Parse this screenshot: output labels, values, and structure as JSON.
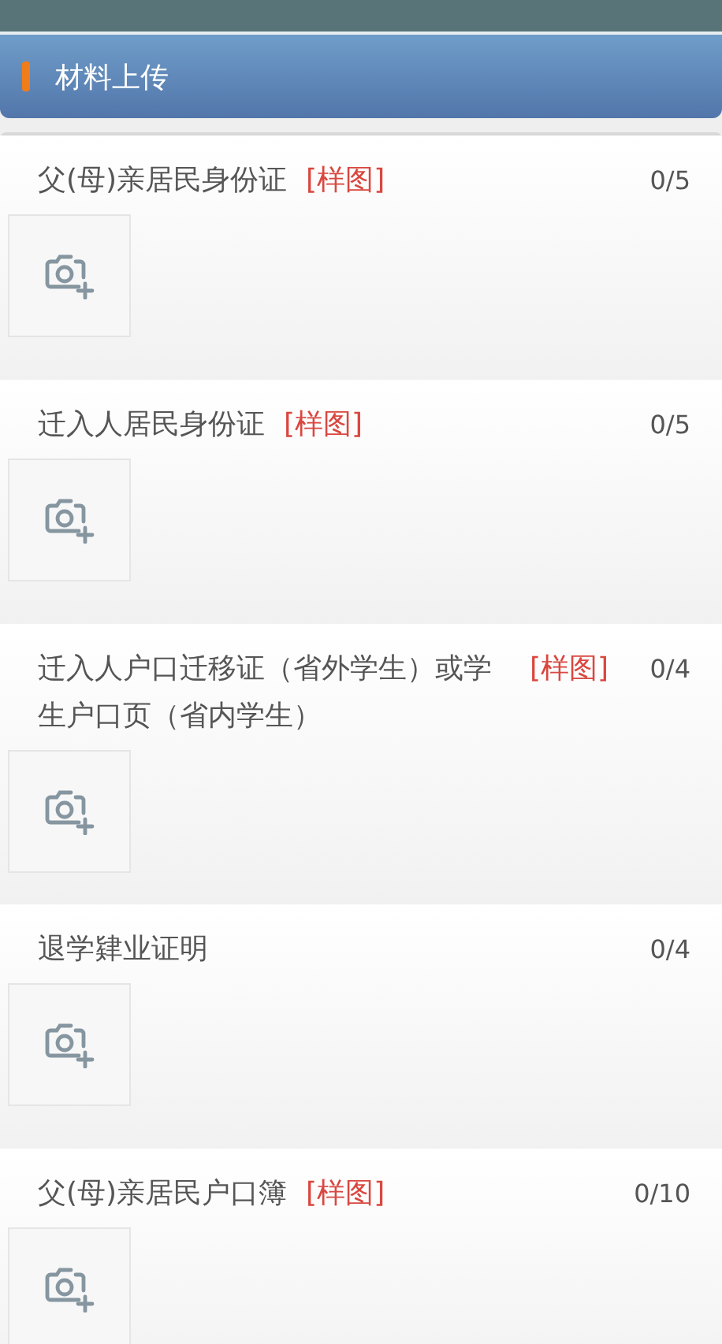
{
  "header": {
    "title": "材料上传"
  },
  "items": [
    {
      "title": "父(母)亲居民身份证",
      "sample": "[样图]",
      "count": "0/5"
    },
    {
      "title": "迁入人居民身份证",
      "sample": "[样图]",
      "count": "0/5"
    },
    {
      "title": "迁入人户口迁移证（省外学生）或学生户口页（省内学生）",
      "sample": "[样图]",
      "count": "0/4"
    },
    {
      "title": "退学肄业证明",
      "count": "0/4"
    },
    {
      "title": "父(母)亲居民户口簿",
      "sample": "[样图]",
      "count": "0/10"
    }
  ]
}
